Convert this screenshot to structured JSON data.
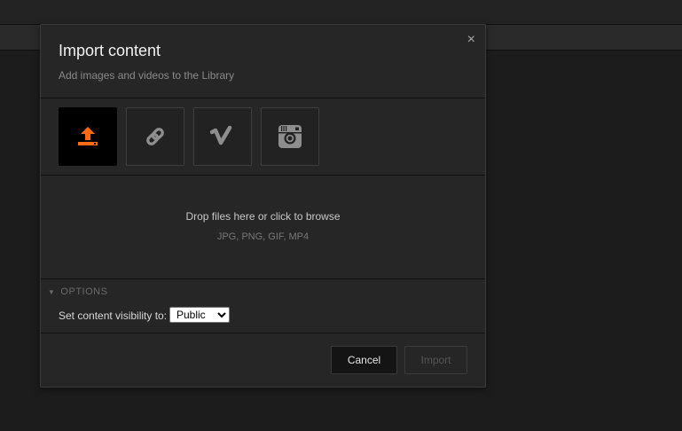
{
  "dialog": {
    "title": "Import content",
    "subtitle": "Add images and videos to the Library",
    "close_glyph": "×"
  },
  "sources": [
    {
      "icon": "upload-icon",
      "active": true
    },
    {
      "icon": "link-icon",
      "active": false
    },
    {
      "icon": "vimeo-icon",
      "active": false
    },
    {
      "icon": "instagram-icon",
      "active": false
    }
  ],
  "dropzone": {
    "main_text": "Drop files here or click to browse",
    "formats": "JPG, PNG, GIF, MP4"
  },
  "options": {
    "toggle_arrow": "▼",
    "toggle_label": "OPTIONS",
    "visibility_label": "Set content visibility to:",
    "visibility_value": "Public"
  },
  "footer": {
    "cancel_label": "Cancel",
    "import_label": "Import"
  },
  "colors": {
    "accent": "#ff6a13"
  }
}
